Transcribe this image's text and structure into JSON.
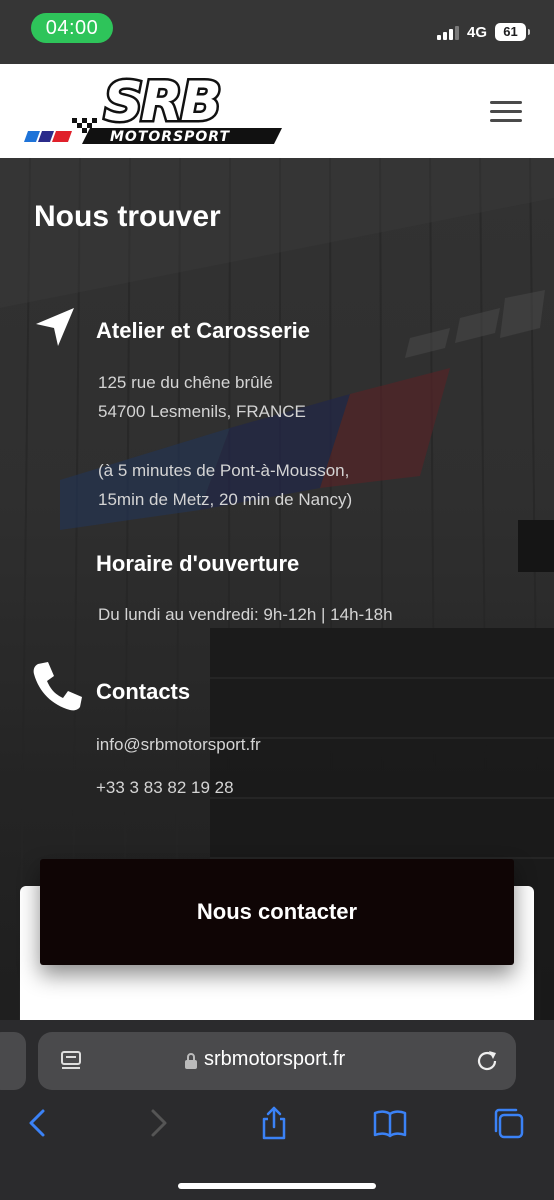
{
  "status_bar": {
    "time": "04:00",
    "network": "4G",
    "battery": "61"
  },
  "header": {
    "logo_text": "SRB",
    "logo_subtext": "MOTORSPORT",
    "menu_icon": "hamburger-menu-icon"
  },
  "main": {
    "title": "Nous trouver",
    "workshop": {
      "icon": "navigation-arrow-icon",
      "heading": "Atelier et Carosserie",
      "address_line1": "125 rue du chêne brûlé",
      "address_line2": "54700 Lesmenils,  FRANCE",
      "note_line1": "(à 5 minutes de Pont-à-Mousson,",
      "note_line2": "15min de Metz, 20 min de Nancy)"
    },
    "hours": {
      "heading": "Horaire d'ouverture",
      "text": "Du lundi au vendredi: 9h-12h | 14h-18h"
    },
    "contacts": {
      "icon": "phone-icon",
      "heading": "Contacts",
      "email": "info@srbmotorsport.fr",
      "phone": "+33 3 83 82 19 28"
    },
    "contact_button": "Nous contacter"
  },
  "browser": {
    "url": "srbmotorsport.fr",
    "toolbar": [
      "back-icon",
      "forward-icon",
      "share-icon",
      "bookmarks-icon",
      "tabs-icon"
    ],
    "accent_color": "#3b82f6"
  }
}
